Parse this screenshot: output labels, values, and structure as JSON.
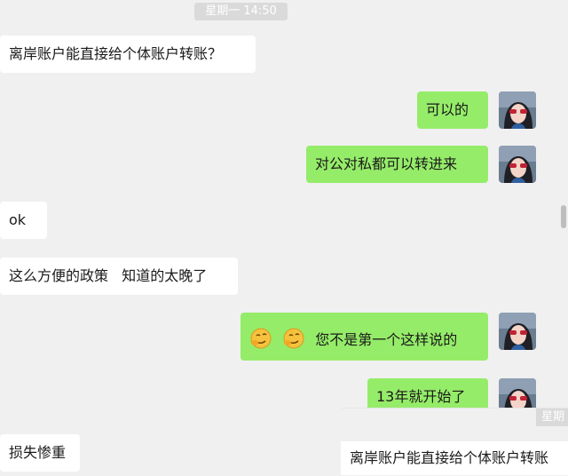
{
  "timestamp": "星期一 14:50",
  "messages": [
    {
      "side": "left",
      "text": "离岸账户能直接给个体账户转账？"
    },
    {
      "side": "right",
      "text": "可以的"
    },
    {
      "side": "right",
      "text": "对公对私都可以转进来"
    },
    {
      "side": "left",
      "text": "ok"
    },
    {
      "side": "left",
      "text": "这么方便的政策   知道的太晚了"
    },
    {
      "side": "right",
      "text": "您不是第一个这样说的",
      "emoji": [
        "smirk-face-icon",
        "smirk-face-icon"
      ]
    },
    {
      "side": "right",
      "text": "13年就开始了"
    },
    {
      "side": "left",
      "text": "损失惨重"
    }
  ],
  "preview": {
    "timestamp": "星期",
    "text": "离岸账户能直接给个体账户转账"
  },
  "colors": {
    "background": "#f0f0f0",
    "left_bubble": "#ffffff",
    "right_bubble": "#95ec69",
    "timestamp_bg": "#dadada"
  }
}
